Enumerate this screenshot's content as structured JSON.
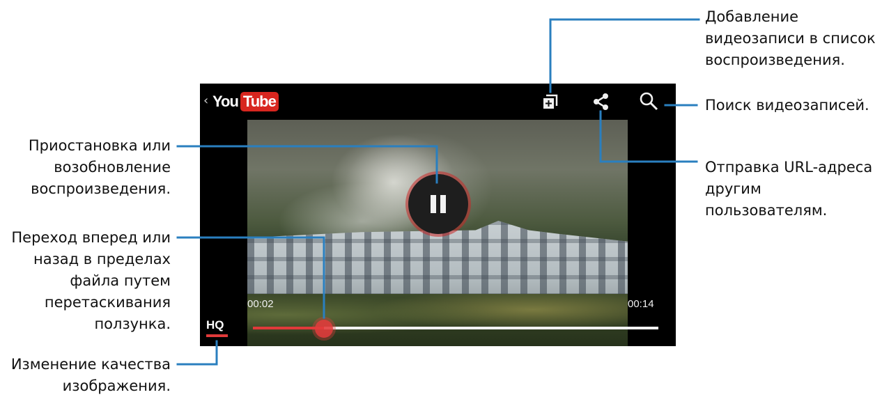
{
  "player": {
    "back_glyph": "‹",
    "logo_you": "You",
    "logo_tube": "Tube",
    "current_time": "00:02",
    "duration": "00:14",
    "progress_fraction": 0.175,
    "quality_label": "HQ",
    "accent_color": "#e03a3a",
    "icons": [
      "add-to-playlist-icon",
      "share-icon",
      "search-icon",
      "pause-icon"
    ]
  },
  "callouts": {
    "add_to_playlist": "Добавление\nвидеозаписи в список\nвоспроизведения.",
    "search": "Поиск видеозаписей.",
    "share_url": "Отправка URL-адреса\nдругим\nпользователям.",
    "pause_resume": "Приостановка или\nвозобновление\nвоспроизведения.",
    "seek": "Переход вперед или\nназад в пределах\nфайла путем\nперетаскивания\nползунка.",
    "quality": "Изменение качества\nизображения."
  }
}
